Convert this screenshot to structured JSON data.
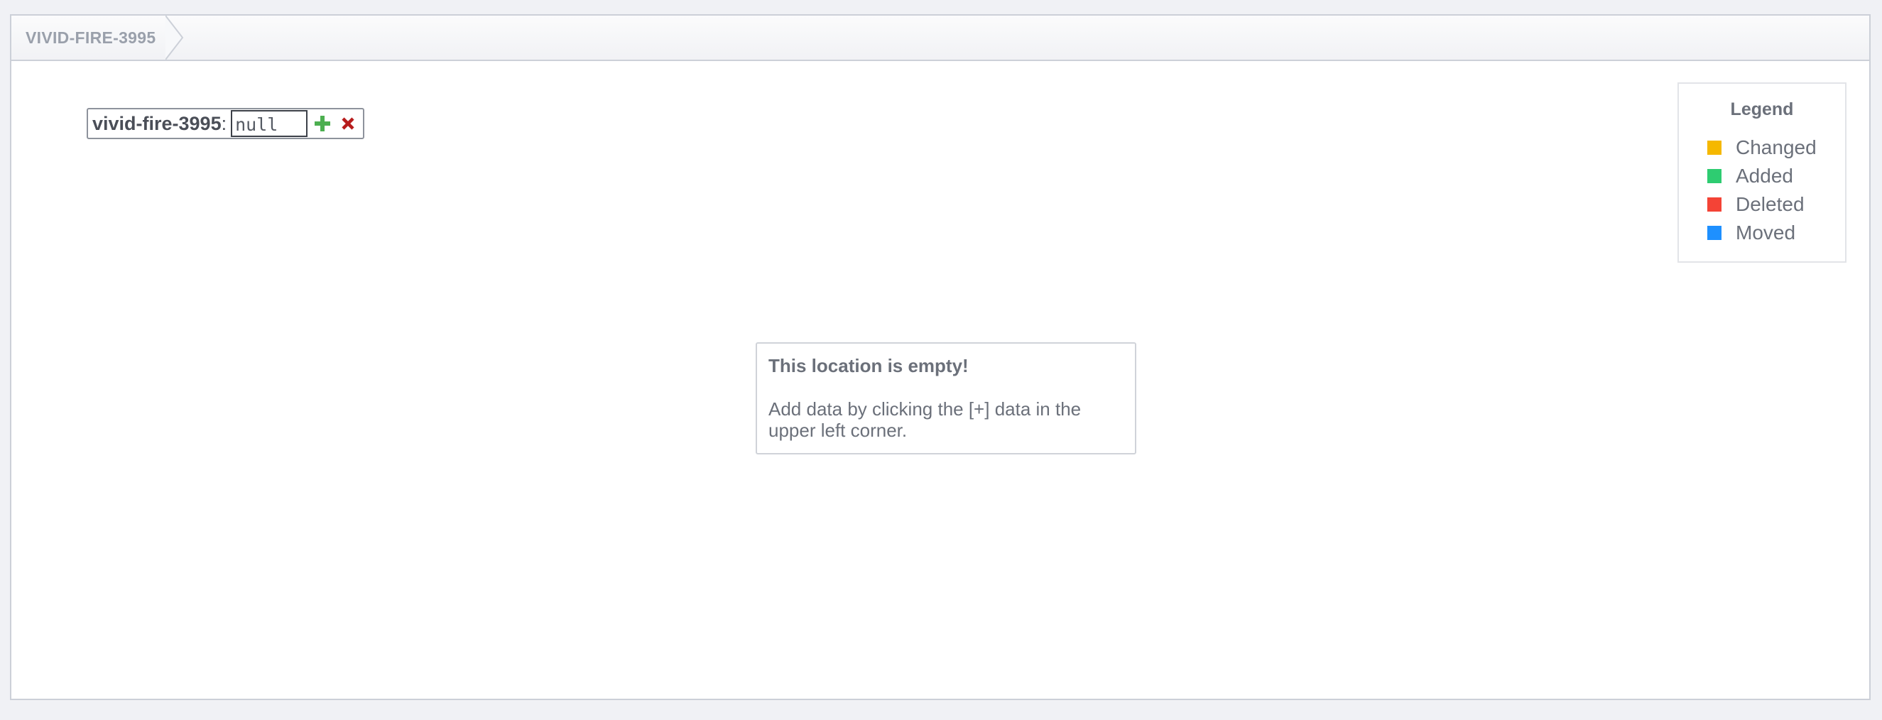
{
  "breadcrumb": {
    "label": "VIVID-FIRE-3995"
  },
  "editor": {
    "key": "vivid-fire-3995",
    "colon": ":",
    "value": "null",
    "add_icon": "plus-icon",
    "remove_icon": "close-icon",
    "add_color": "#4caf50",
    "remove_color": "#b71c1c"
  },
  "legend": {
    "title": "Legend",
    "items": [
      {
        "label": "Changed",
        "color": "#f5b800"
      },
      {
        "label": "Added",
        "color": "#2ecc71"
      },
      {
        "label": "Deleted",
        "color": "#f44336"
      },
      {
        "label": "Moved",
        "color": "#1e90ff"
      }
    ]
  },
  "empty_message": {
    "title": "This location is empty!",
    "text": "Add data by clicking the [+] data in the upper left corner."
  }
}
